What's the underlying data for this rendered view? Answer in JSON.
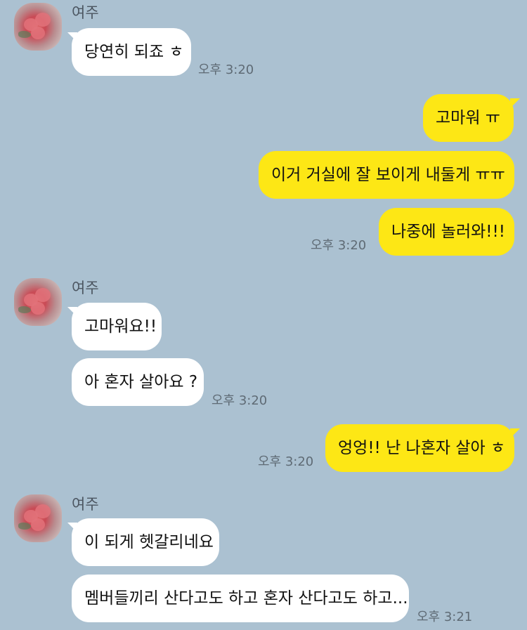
{
  "contact": {
    "name": "여주"
  },
  "messages": [
    {
      "text": "당연히 되죠 ㅎ",
      "time": "오후 3:20"
    },
    {
      "text": "고마워 ㅠ"
    },
    {
      "text": "이거 거실에 잘 보이게 내둘게 ㅠㅠ"
    },
    {
      "text": "나중에 놀러와!!!",
      "time": "오후 3:20"
    },
    {
      "text": "고마워요!!"
    },
    {
      "text": "아 혼자 살아요 ?",
      "time": "오후 3:20"
    },
    {
      "text": "엉엉!! 난 나혼자 살아 ㅎ",
      "time": "오후 3:20"
    },
    {
      "text": "이 되게 헷갈리네요"
    },
    {
      "text": "멤버들끼리 산다고도 하고 혼자 산다고도 하고...",
      "time": "오후 3:21"
    }
  ],
  "colors": {
    "background": "#abc1d1",
    "incoming_bubble": "#ffffff",
    "outgoing_bubble": "#fde715"
  }
}
